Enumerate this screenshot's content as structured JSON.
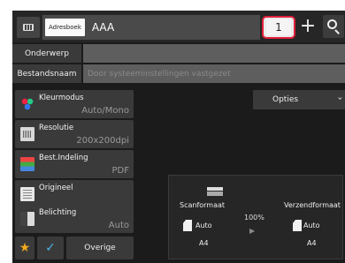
{
  "header": {
    "address_tag": "Adresboek",
    "address_value": "AAA",
    "count": "1",
    "plus_symbol": "+"
  },
  "fields": {
    "subject_label": "Onderwerp",
    "subject_value": "",
    "filename_label": "Bestandsnaam",
    "filename_placeholder": "Door systeeminstellingen vastgezet"
  },
  "settings": [
    {
      "name": "Kleurmodus",
      "value": "Auto/Mono",
      "icon": "color-mode-icon"
    },
    {
      "name": "Resolutie",
      "value": "200x200dpi",
      "icon": "resolution-icon"
    },
    {
      "name": "Best.Indeling",
      "value": "PDF",
      "icon": "file-format-icon"
    },
    {
      "name": "Origineel",
      "value": "",
      "icon": "original-icon"
    },
    {
      "name": "Belichting",
      "value": "Auto",
      "icon": "exposure-icon"
    }
  ],
  "bottom_buttons": {
    "favorite_icon": "★",
    "check_icon": "✓",
    "other_label": "Overige"
  },
  "options_tab": {
    "label": "Opties",
    "chevron": "›"
  },
  "scan_panel": {
    "scan_size_label": "Scanformaat",
    "scan_size_mode": "Auto",
    "scan_size_paper": "A4",
    "ratio": "100%",
    "arrow": "▶",
    "send_size_label": "Verzendformaat",
    "send_size_mode": "Auto",
    "send_size_paper": "A4"
  },
  "colors": {
    "background": "#1b1b1b",
    "button": "#3a3a3a",
    "highlight_ring": "#e0203a",
    "value_text": "#9a9a9a",
    "favorite": "#f2a81d",
    "check": "#4fb0e8"
  }
}
